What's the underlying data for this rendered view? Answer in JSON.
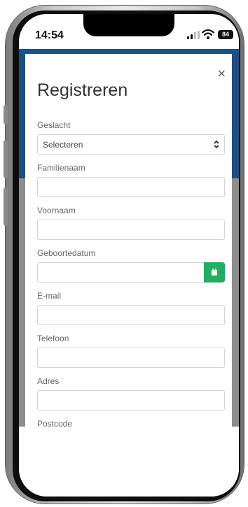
{
  "status_bar": {
    "time": "14:54",
    "battery": "84"
  },
  "modal": {
    "close_glyph": "×",
    "title": "Registreren",
    "fields": {
      "gender": {
        "label": "Geslacht",
        "value": "Selecteren"
      },
      "lastname": {
        "label": "Familienaam",
        "value": ""
      },
      "firstname": {
        "label": "Voornaam",
        "value": ""
      },
      "birthdate": {
        "label": "Geboortedatum",
        "value": ""
      },
      "email": {
        "label": "E-mail",
        "value": ""
      },
      "phone": {
        "label": "Telefoon",
        "value": ""
      },
      "address": {
        "label": "Adres",
        "value": ""
      },
      "postcode": {
        "label": "Postcode",
        "value": ""
      }
    }
  },
  "colors": {
    "header_blue": "#1c4f82",
    "accent_green": "#22ad63",
    "overlay_grey": "#8d8d8d"
  },
  "icons": {
    "close": "close-icon",
    "select_arrow": "chevron-updown-icon",
    "calendar": "calendar-icon"
  }
}
